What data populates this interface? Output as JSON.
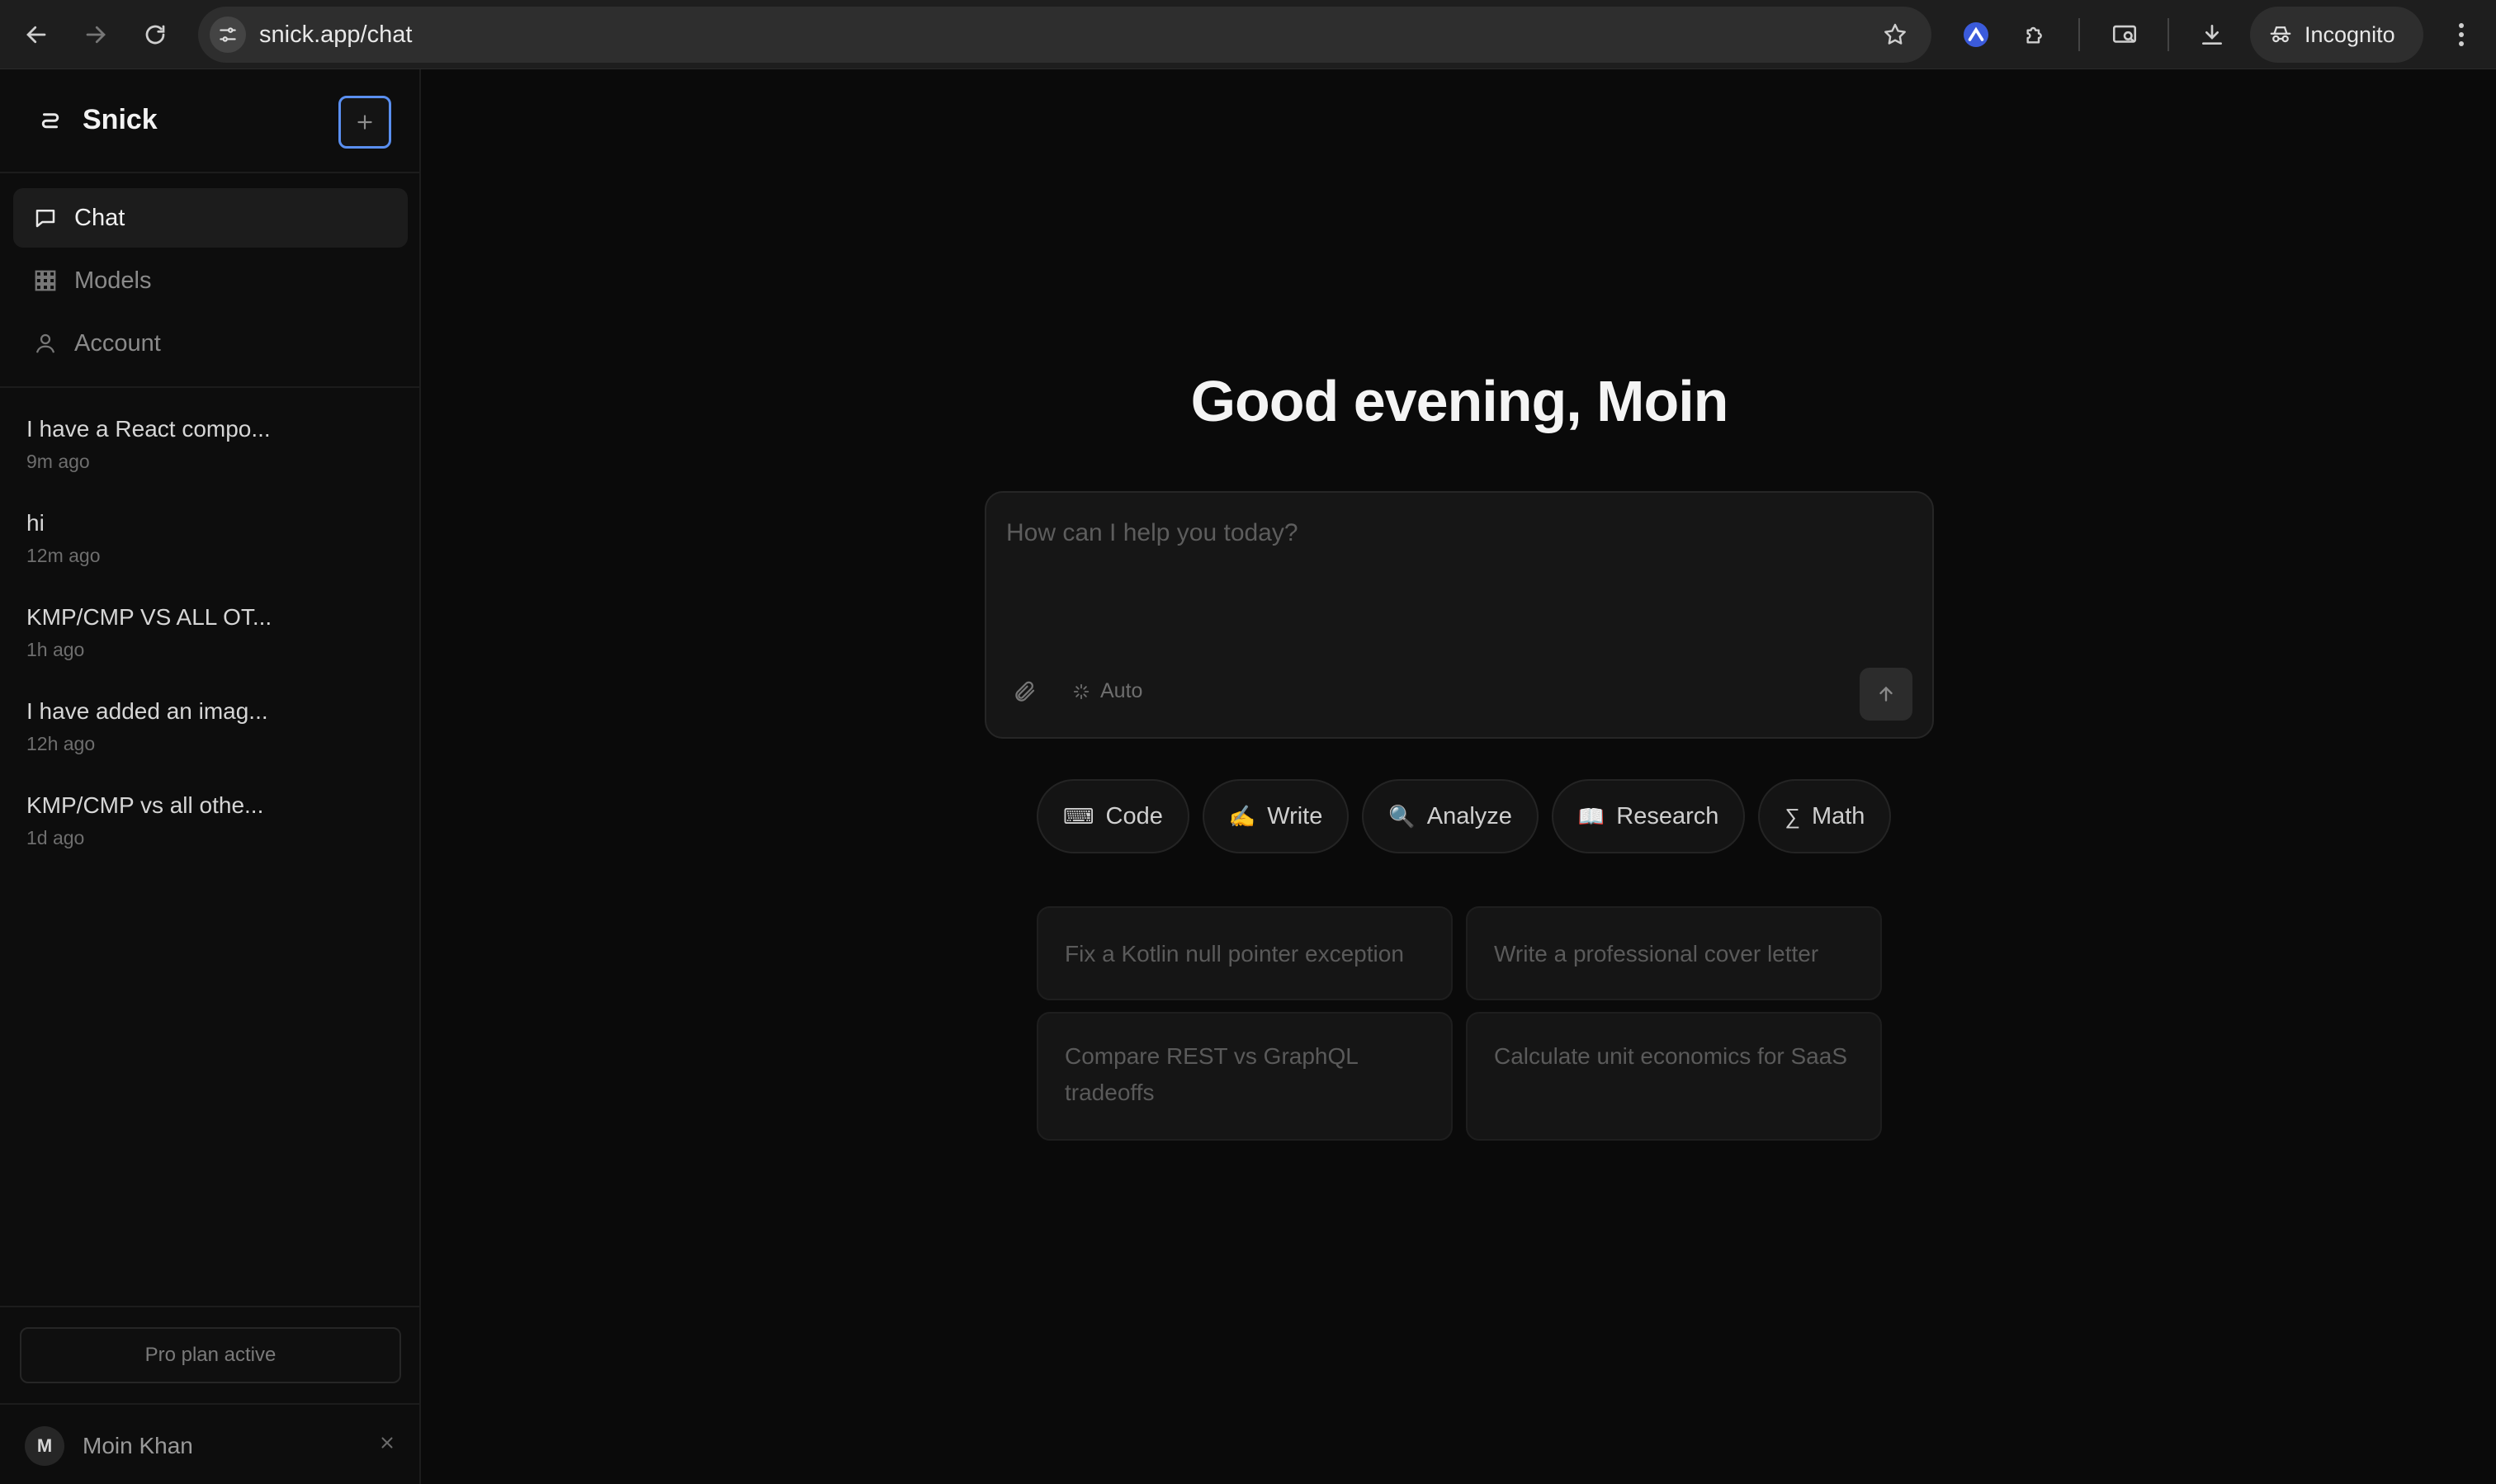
{
  "browser": {
    "url": "snick.app/chat",
    "incognito_label": "Incognito"
  },
  "sidebar": {
    "brand": "Snick",
    "nav": [
      {
        "label": "Chat",
        "icon": "chat-bubble-icon",
        "active": true
      },
      {
        "label": "Models",
        "icon": "grid-icon",
        "active": false
      },
      {
        "label": "Account",
        "icon": "user-icon",
        "active": false
      }
    ],
    "history": [
      {
        "title": "I have a React compo...",
        "time": "9m ago"
      },
      {
        "title": "hi",
        "time": "12m ago"
      },
      {
        "title": "KMP/CMP VS ALL OT...",
        "time": "1h ago"
      },
      {
        "title": "I have added an imag...",
        "time": "12h ago"
      },
      {
        "title": "KMP/CMP vs all othe...",
        "time": "1d ago"
      }
    ],
    "plan_status": "Pro plan active",
    "user": {
      "initial": "M",
      "name": "Moin Khan"
    }
  },
  "main": {
    "greeting": "Good evening, Moin",
    "composer": {
      "placeholder": "How can I help you today?",
      "model_label": "Auto"
    },
    "chips": [
      {
        "icon": "⌨",
        "label": "Code"
      },
      {
        "icon": "✍️",
        "label": "Write"
      },
      {
        "icon": "🔍",
        "label": "Analyze"
      },
      {
        "icon": "📖",
        "label": "Research"
      },
      {
        "icon": "∑",
        "label": "Math"
      }
    ],
    "suggestions": [
      "Fix a Kotlin null pointer exception",
      "Write a professional cover letter",
      "Compare REST vs GraphQL tradeoffs",
      "Calculate unit economics for SaaS"
    ]
  },
  "colors": {
    "accent_focus": "#5a8ff0",
    "background": "#0a0a0a"
  }
}
